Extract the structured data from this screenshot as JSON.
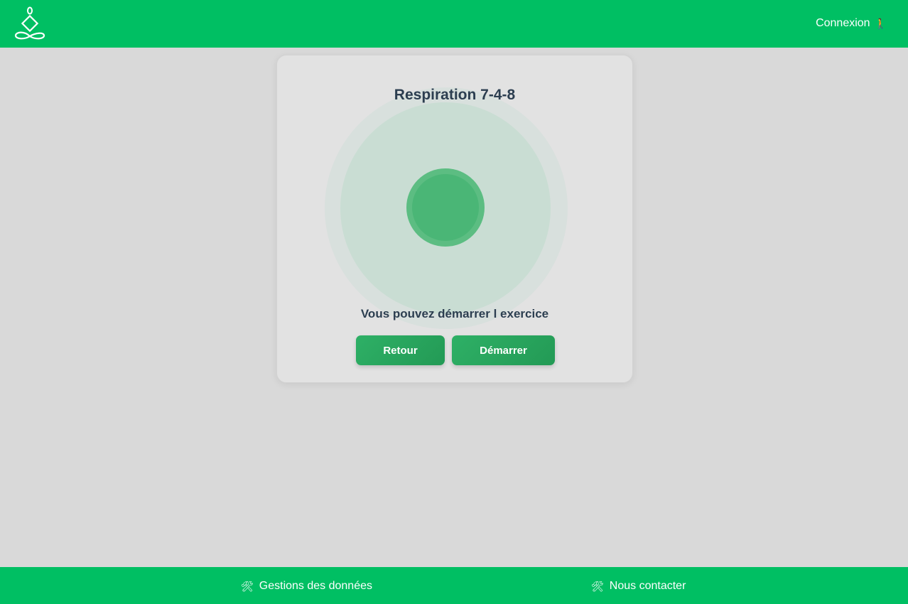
{
  "header": {
    "logo_icon": "meditation-figure-icon",
    "login_label": "Connexion",
    "login_icon": "person-walking-icon"
  },
  "exercise": {
    "title": "Respiration 7-4-8",
    "status": "Vous pouvez démarrer l exercice",
    "buttons": {
      "back": "Retour",
      "start": "Démarrer"
    }
  },
  "footer": {
    "links": [
      {
        "label": "Gestions des données",
        "icon": "tools-icon"
      },
      {
        "label": "Nous contacter",
        "icon": "tools-icon"
      }
    ]
  },
  "colors": {
    "brand_green": "#00bf63",
    "button_green": "#2eb066",
    "text_dark": "#2c3e50",
    "background": "#d9d9d9"
  }
}
